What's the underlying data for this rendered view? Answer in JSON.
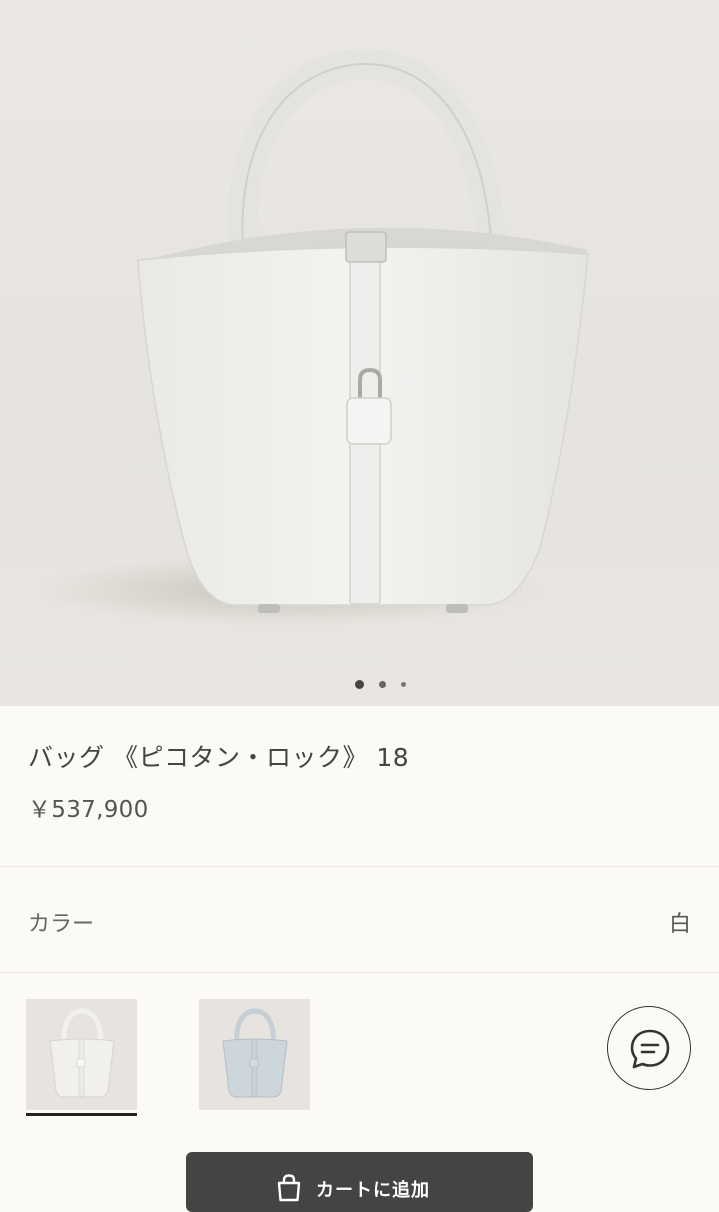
{
  "product": {
    "title": "バッグ 《ピコタン・ロック》 18",
    "price": "￥537,900"
  },
  "gallery": {
    "active_index": 0,
    "dot_count": 3,
    "main_image": "white-picotin-bag-photo"
  },
  "color": {
    "label": "カラー",
    "value": "白"
  },
  "swatches": [
    {
      "name": "white",
      "tone": "#f1f0ed",
      "selected": true
    },
    {
      "name": "light-blue",
      "tone": "#cdd6db",
      "selected": false
    }
  ],
  "chat": {
    "icon": "chat-bubble-icon"
  },
  "cart": {
    "label": "カートに追加",
    "icon": "shopping-bag-icon"
  },
  "colors": {
    "background": "#fcfaf6",
    "button": "#444444",
    "text": "#444444"
  }
}
